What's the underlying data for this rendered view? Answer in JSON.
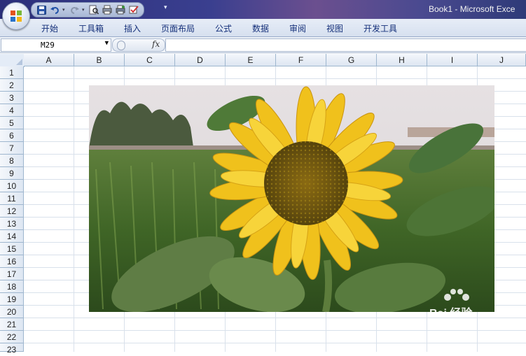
{
  "window": {
    "title": "Book1 - Microsoft Exce"
  },
  "quick_access": {
    "icons": [
      "save-icon",
      "undo-icon",
      "redo-icon",
      "print-preview-icon",
      "print-icon",
      "quick-print-icon",
      "spelling-icon"
    ],
    "more_glyph": "▾"
  },
  "ribbon": {
    "tabs": [
      "开始",
      "工具箱",
      "插入",
      "页面布局",
      "公式",
      "数据",
      "审阅",
      "视图",
      "开发工具"
    ]
  },
  "formula_bar": {
    "name_box": "M29",
    "fx_label": "fx",
    "value": ""
  },
  "columns": [
    "A",
    "B",
    "C",
    "D",
    "E",
    "F",
    "G",
    "H",
    "I",
    "J"
  ],
  "rows": [
    "1",
    "2",
    "3",
    "4",
    "5",
    "6",
    "7",
    "8",
    "9",
    "10",
    "11",
    "12",
    "13",
    "14",
    "15",
    "16",
    "17",
    "18",
    "19",
    "20",
    "21",
    "22",
    "23"
  ],
  "picture": {
    "subject": "sunflower",
    "watermark": "Bai 经验"
  },
  "colors": {
    "title_bar": "#3a3f8f",
    "ribbon": "#dfe7f3",
    "grid_line": "#d9e1eb",
    "header": "#e4ecf7"
  }
}
